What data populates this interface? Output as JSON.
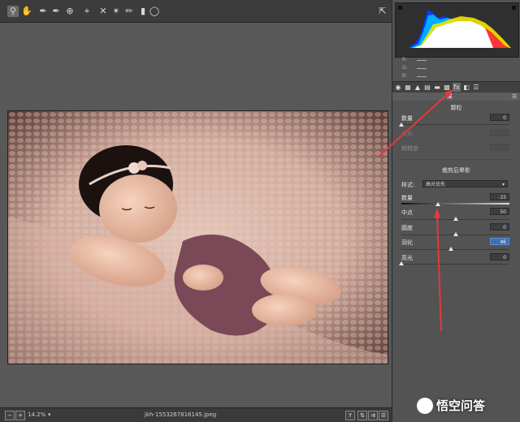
{
  "toolbar": {
    "tools": [
      "zoom-icon",
      "hand-icon",
      "eyedropper-icon",
      "color-sampler-icon",
      "target-adjust-icon",
      "crop-icon",
      "straighten-icon",
      "spot-removal-icon",
      "brush-icon",
      "graduated-filter-icon",
      "radial-filter-icon"
    ],
    "active_tool": "zoom-icon"
  },
  "histogram": {
    "r_label": "R:",
    "g_label": "G:",
    "b_label": "B:"
  },
  "effects_panel": {
    "header": "果",
    "grain": {
      "title": "颗粒",
      "amount_label": "数量",
      "amount_value": "0",
      "size_label": "大小",
      "roughness_label": "粗糙度"
    },
    "vignette": {
      "title": "裁剪后晕影",
      "style_label": "样式:",
      "style_value": "高光优先",
      "amount_label": "数量",
      "amount_value": "-33",
      "amount_fraction": 0.34,
      "midpoint_label": "中点",
      "midpoint_value": "50",
      "midpoint_fraction": 0.5,
      "roundness_label": "圆度",
      "roundness_value": "0",
      "roundness_fraction": 0.5,
      "feather_label": "羽化",
      "feather_value": "46",
      "feather_fraction": 0.46,
      "highlights_label": "高光",
      "highlights_value": "0",
      "highlights_fraction": 0.0
    }
  },
  "statusbar": {
    "zoom": "14.2%",
    "filename": "jkh-1553267816145.jpeg",
    "y_label": "Y"
  },
  "watermark": {
    "text": "悟空问答"
  }
}
